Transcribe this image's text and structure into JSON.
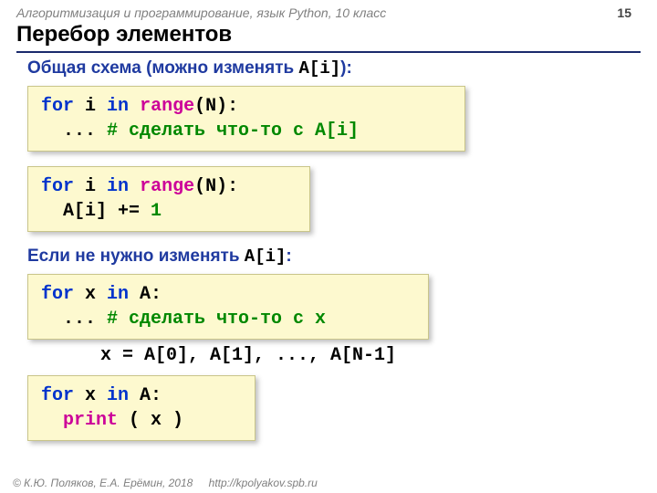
{
  "header": {
    "course": "Алгоритмизация и программирование, язык Python, 10 класс",
    "page": "15"
  },
  "title": "Перебор элементов",
  "section1": {
    "label_pre": "Общая схема (можно изменять ",
    "label_code": "A[i]",
    "label_post": "):"
  },
  "code1": {
    "l1a": "for",
    "l1b": " i ",
    "l1c": "in",
    "l1d": " ",
    "l1e": "range",
    "l1f": "(N):",
    "l2a": "  ... ",
    "l2b": "# сделать что-то c A[i]"
  },
  "code2": {
    "l1a": "for",
    "l1b": " i ",
    "l1c": "in",
    "l1d": " ",
    "l1e": "range",
    "l1f": "(N):",
    "l2a": "  A[i] += ",
    "l2b": "1"
  },
  "section2": {
    "label_pre": "Если не нужно изменять ",
    "label_code": "A[i]",
    "label_post": ":"
  },
  "code3": {
    "l1a": "for",
    "l1b": " x ",
    "l1c": "in",
    "l1d": " A:",
    "l2a": "  ... ",
    "l2b": "# сделать что-то c x"
  },
  "xnote": "x = A[0], A[1], ..., A[N-1]",
  "code4": {
    "l1a": "for",
    "l1b": " x ",
    "l1c": "in",
    "l1d": " A:",
    "l2a": "  ",
    "l2b": "print",
    "l2c": " ( x )"
  },
  "footer": {
    "copyright": "© К.Ю. Поляков, Е.А. Ерёмин, 2018",
    "url": "http://kpolyakov.spb.ru"
  }
}
